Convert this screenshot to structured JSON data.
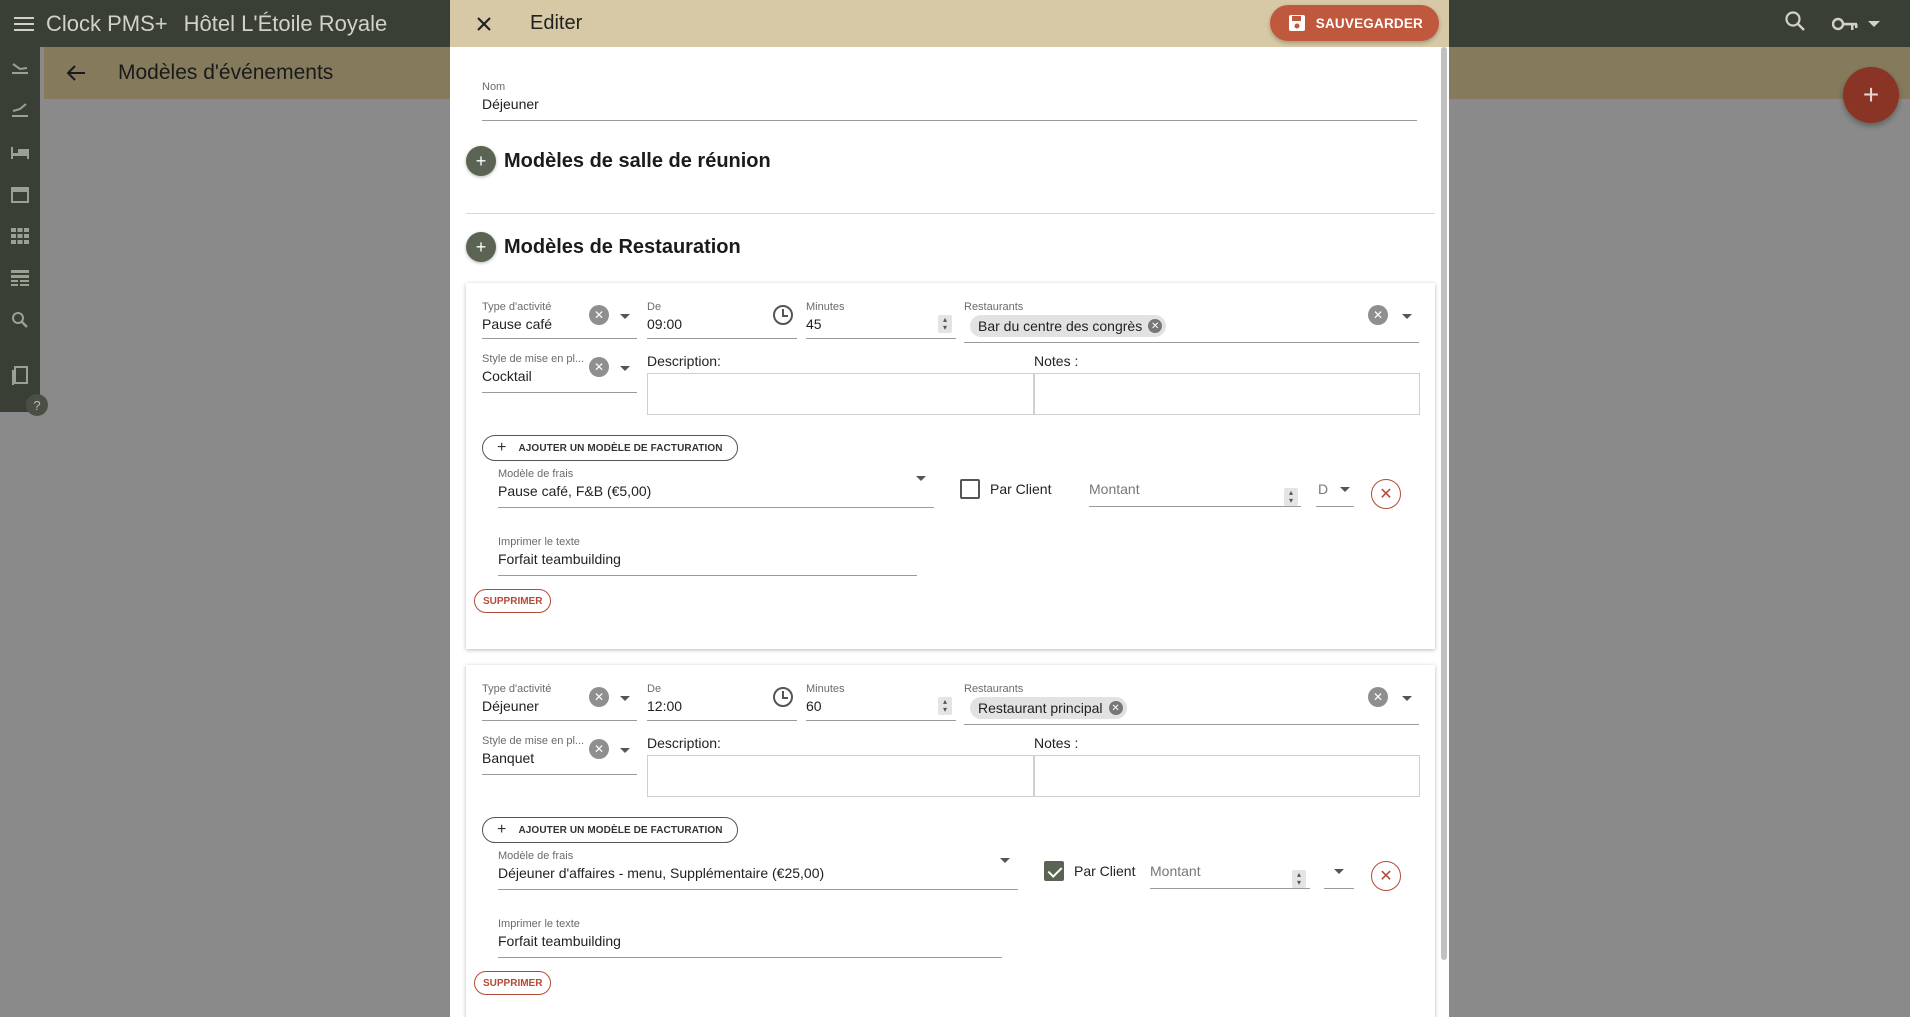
{
  "app": {
    "name": "Clock PMS+",
    "hotel": "Hôtel L'Étoile Royale",
    "page_title": "Modèles d'événements",
    "fab_label": "+",
    "help_label": "?"
  },
  "dialog": {
    "title": "Editer",
    "save_label": "SAUVEGARDER",
    "name_label": "Nom",
    "name_value": "Déjeuner",
    "section_meeting": "Modèles de salle de réunion",
    "section_catering": "Modèles de Restauration",
    "plus": "+"
  },
  "labels": {
    "activity_type": "Type d'activité",
    "from": "De",
    "minutes": "Minutes",
    "restaurants": "Restaurants",
    "setup_style": "Style de mise en pl...",
    "description": "Description:",
    "notes": "Notes :",
    "add_billing": "AJOUTER UN MODÈLE DE FACTURATION",
    "fee_model": "Modèle de frais",
    "per_client": "Par Client",
    "amount": "Montant",
    "print_text": "Imprimer le texte",
    "delete": "SUPPRIMER"
  },
  "catering": [
    {
      "activity_type": "Pause café",
      "from": "09:00",
      "minutes": "45",
      "restaurant_chip": "Bar du centre des congrès",
      "setup_style": "Cocktail",
      "fee_model": "Pause café, F&B (€5,00)",
      "per_client_checked": false,
      "amount_unit": "D",
      "print_text": "Forfait teambuilding"
    },
    {
      "activity_type": "Déjeuner",
      "from": "12:00",
      "minutes": "60",
      "restaurant_chip": "Restaurant principal",
      "setup_style": "Banquet",
      "fee_model": "Déjeuner d'affaires - menu, Supplémentaire (€25,00)",
      "per_client_checked": true,
      "amount_unit": "",
      "print_text": "Forfait teambuilding"
    }
  ],
  "colors": {
    "topbar": "#3a3f36",
    "subbar": "#857a5c",
    "dialog_header": "#d7c9a5",
    "save_button": "#c0583d",
    "accent_green": "#5b6352",
    "danger": "#b34a35"
  },
  "icons": [
    "menu-icon",
    "search-icon",
    "key-icon",
    "back-arrow-icon",
    "close-icon",
    "save-icon",
    "clock-icon",
    "clear-icon",
    "dropdown-caret-icon",
    "plus-icon"
  ]
}
